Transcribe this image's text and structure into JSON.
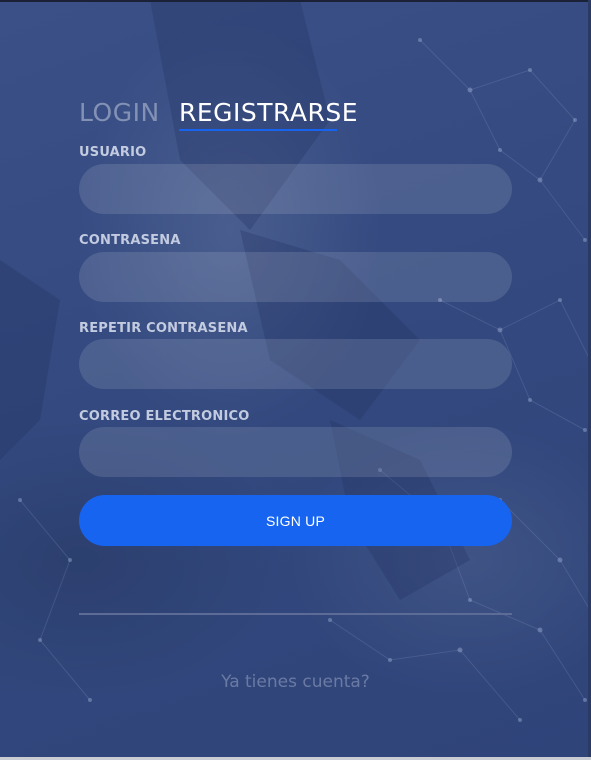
{
  "tabs": {
    "login": "LOGIN",
    "register": "REGISTRARSE",
    "active": "register"
  },
  "form": {
    "username_label": "USUARIO",
    "username_value": "",
    "password_label": "CONTRASENA",
    "password_value": "",
    "repeat_password_label": "REPETIR CONTRASENA",
    "repeat_password_value": "",
    "email_label": "CORREO ELECTRONICO",
    "email_value": "",
    "submit_label": "SIGN UP"
  },
  "footer": {
    "link_text": "Ya tienes cuenta?"
  },
  "colors": {
    "background": "#34497f",
    "accent": "#1664f0",
    "field_bg": "rgba(255,255,255,0.12)",
    "label": "#c3cbe0"
  }
}
